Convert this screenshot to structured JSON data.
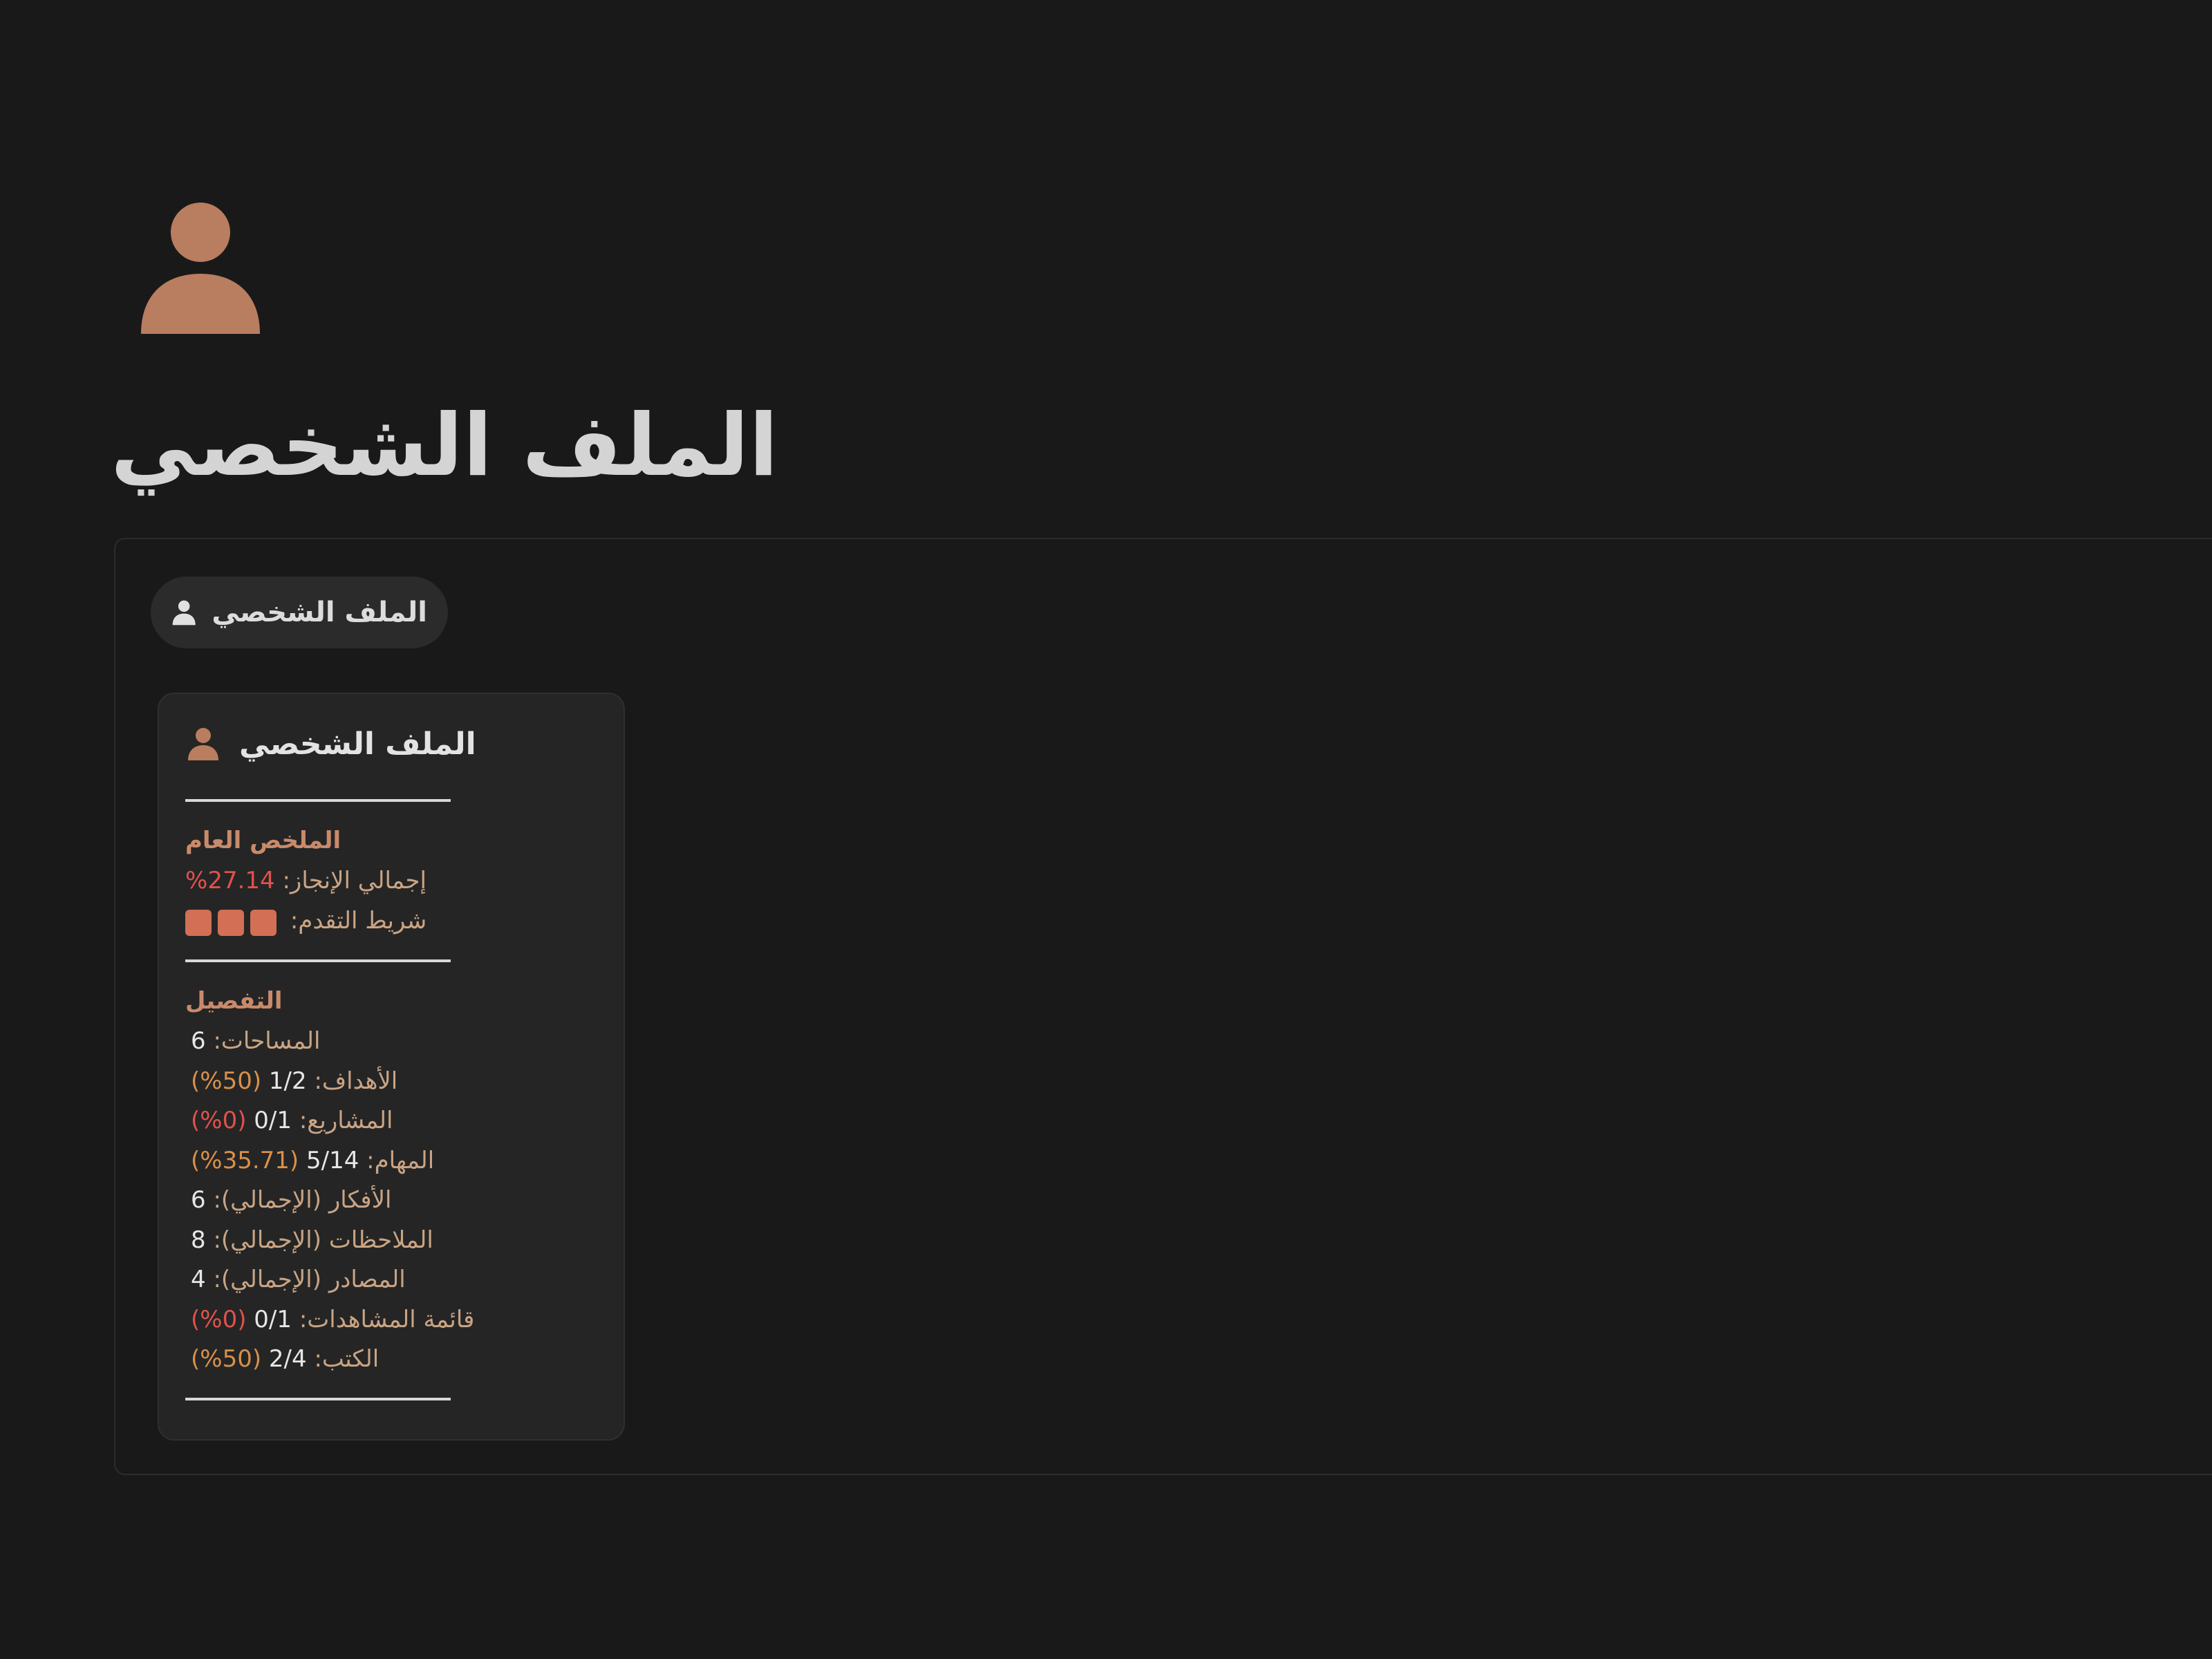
{
  "page": {
    "title": "الملف الشخصي",
    "icon": "person-icon",
    "accent_color": "#b97d5f"
  },
  "view_tab": {
    "label": "الملف الشخصي",
    "icon": "person-icon"
  },
  "card": {
    "title": "الملف الشخصي",
    "icon": "person-icon",
    "summary": {
      "heading": "الملخص العام",
      "completion_label": "إجمالي الإنجاز:",
      "completion_value": "27.14%",
      "progress_label": "شريط التقدم:",
      "progress_blocks": 3
    },
    "details": {
      "heading": "التفصيل",
      "rows": [
        {
          "label": "المساحات:",
          "value": "6",
          "pct": "",
          "pct_color": ""
        },
        {
          "label": "الأهداف:",
          "value": "1/2",
          "pct": "(50%)",
          "pct_color": "orange"
        },
        {
          "label": "المشاريع:",
          "value": "0/1",
          "pct": "(0%)",
          "pct_color": "red"
        },
        {
          "label": "المهام:",
          "value": "5/14",
          "pct": "(35.71%)",
          "pct_color": "orange"
        },
        {
          "label": "الأفكار (الإجمالي):",
          "value": "6",
          "pct": "",
          "pct_color": ""
        },
        {
          "label": "الملاحظات (الإجمالي):",
          "value": "8",
          "pct": "",
          "pct_color": ""
        },
        {
          "label": "المصادر (الإجمالي):",
          "value": "4",
          "pct": "",
          "pct_color": ""
        },
        {
          "label": "قائمة المشاهدات:",
          "value": "0/1",
          "pct": "(0%)",
          "pct_color": "red"
        },
        {
          "label": "الكتب:",
          "value": "2/4",
          "pct": "(50%)",
          "pct_color": "orange"
        }
      ]
    }
  }
}
